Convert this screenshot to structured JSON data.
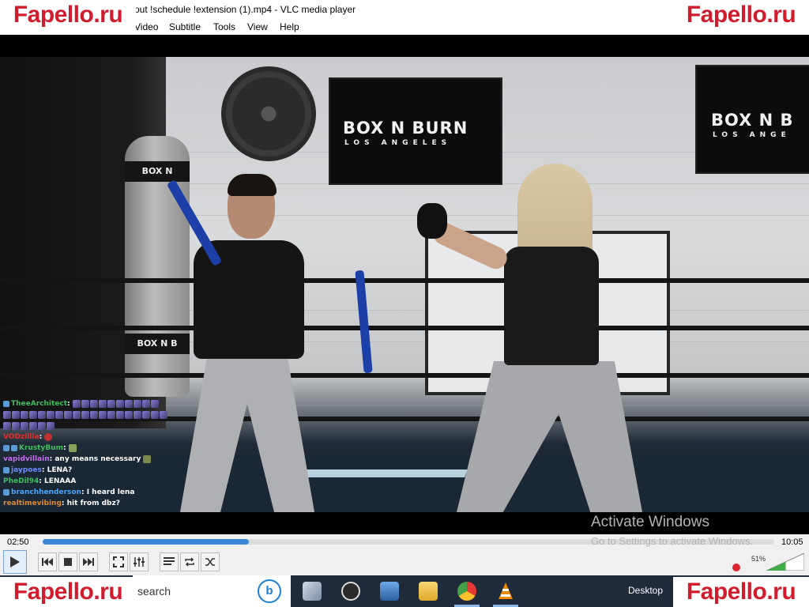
{
  "window": {
    "title": "out !schedule !extension (1).mp4 - VLC media player"
  },
  "menu": {
    "items": [
      "Video",
      "Subtitle",
      "Tools",
      "View",
      "Help"
    ]
  },
  "watermark": {
    "text": "Fapello.ru"
  },
  "video": {
    "signs": {
      "tv1_logo": "BOX N BURN",
      "tv1_sub": "LOS ANGELES",
      "tv2_logo": "BOX N B",
      "tv2_sub": "LOS ANGE",
      "bag_top": "BOX N",
      "bag_bottom": "BOX N B"
    },
    "chat": [
      {
        "user": "TheeArchitect",
        "user_color": "#3fbf5f",
        "message": ""
      },
      {
        "user": "VODzillla",
        "user_color": "#e03030",
        "message": ""
      },
      {
        "user": "KrustyBum",
        "user_color": "#3fbf5f",
        "message": ""
      },
      {
        "user": "vapidvillain",
        "user_color": "#c56cf0",
        "message": "any means necessary"
      },
      {
        "user": "jaypoes",
        "user_color": "#6b8cff",
        "message": "LENA?"
      },
      {
        "user": "PheDil94",
        "user_color": "#3fbf5f",
        "message": "LENAAA"
      },
      {
        "user": "branchhenderson",
        "user_color": "#4aa6ff",
        "message": "I heard lena"
      },
      {
        "user": "realtimevibing",
        "user_color": "#e08a30",
        "message": "hit from dbz?"
      }
    ],
    "activate": {
      "title": "Activate Windows",
      "subtitle": "Go to Settings to activate Windows."
    }
  },
  "playback": {
    "elapsed": "02:50",
    "total": "10:05",
    "progress": 0.282,
    "volume_label": "51%",
    "volume": 0.51
  },
  "controls": {
    "icons": [
      "play-icon",
      "previous-icon",
      "stop-icon",
      "next-icon",
      "fullscreen-icon",
      "extended-settings-icon",
      "playlist-icon",
      "loop-icon",
      "shuffle-icon"
    ]
  },
  "taskbar": {
    "search_text": "search",
    "desktop_label": "Desktop",
    "apps": [
      "file-explorer-icon",
      "obs-icon",
      "network-app-icon",
      "folder-icon",
      "chrome-icon",
      "vlc-icon"
    ]
  }
}
